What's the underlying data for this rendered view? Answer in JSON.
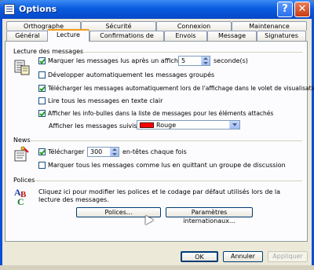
{
  "window": {
    "title": "Options",
    "help_glyph": "?",
    "close_glyph": "✕"
  },
  "tabs_back": [
    "Orthographe",
    "Sécurité",
    "Connexion",
    "Maintenance"
  ],
  "tabs_front": [
    "Général",
    "Lecture",
    "Confirmations de lecture",
    "Envois",
    "Message",
    "Signatures"
  ],
  "active_tab": "Lecture",
  "lecture": {
    "title": "Lecture des messages",
    "mark_read": {
      "label": "Marquer les messages lus après un affichage de",
      "value": "5",
      "unit": "seconde(s)",
      "checked": true
    },
    "expand_groups": {
      "label": "Développer automatiquement les messages groupés",
      "checked": false
    },
    "auto_download": {
      "label": "Télécharger les messages automatiquement lors de l'affichage dans le volet de visualisation",
      "checked": true
    },
    "plain_text": {
      "label": "Lire tous les messages en texte clair",
      "checked": false
    },
    "tooltips": {
      "label": "Afficher les info-bulles dans la liste de messages pour les éléments attachés",
      "checked": true
    },
    "followed_label": "Afficher les messages suivis en :",
    "followed_color": {
      "value": "Rouge",
      "swatch": "#ff0000"
    }
  },
  "news": {
    "title": "News",
    "download": {
      "label": "Télécharger",
      "value": "300",
      "suffix": "en-têtes chaque fois",
      "checked": true
    },
    "mark_all": {
      "label": "Marquer tous les messages comme lus en quittant un groupe de discussion",
      "checked": false
    }
  },
  "fonts": {
    "title": "Polices",
    "description": "Cliquez ici pour modifier les polices et le codage par défaut utilisés lors de la lecture des messages.",
    "fonts_button": "Polices...",
    "intl_button": "Paramètres internationaux..."
  },
  "footer": {
    "ok": "OK",
    "cancel": "Annuler",
    "apply": "Appliquer"
  },
  "colors": {
    "titlebar": "#0a5be0",
    "dialog": "#ece9d8",
    "tab_highlight": "#f29c1e",
    "followed": "#ff0000"
  }
}
